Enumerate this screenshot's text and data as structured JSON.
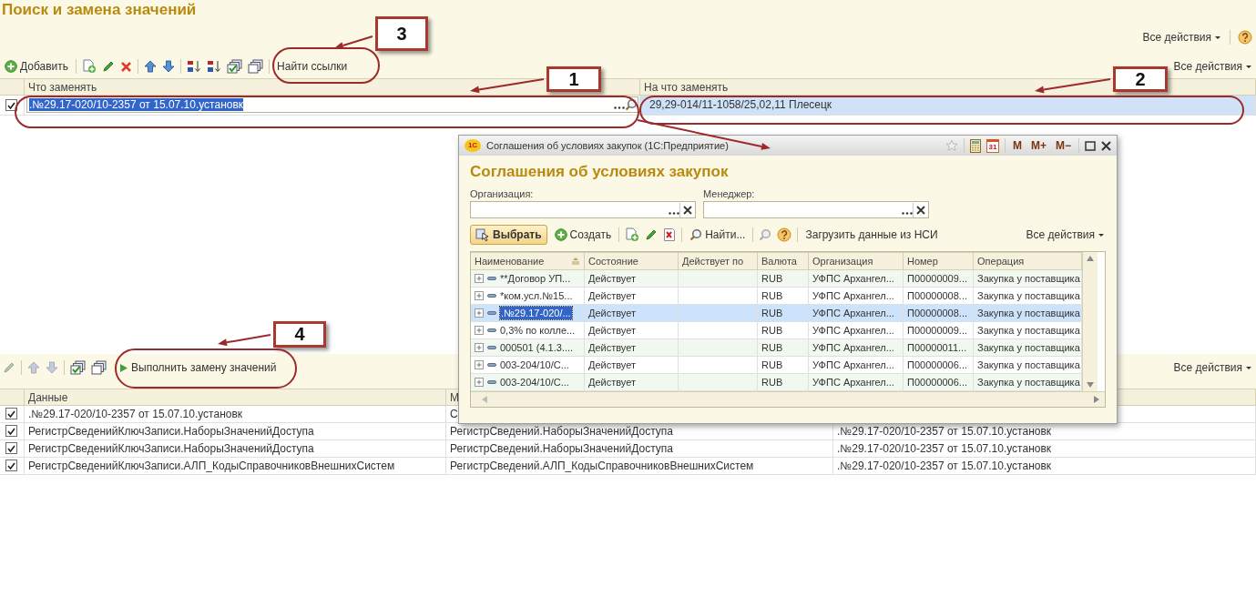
{
  "page": {
    "title": "Поиск и замена значений",
    "all_actions": "Все действия"
  },
  "top_toolbar": {
    "add": "Добавить",
    "find_links": "Найти ссылки",
    "all_actions": "Все действия"
  },
  "replace_table": {
    "columns": [
      "Что заменять",
      "На что заменять"
    ],
    "rows": [
      {
        "checked": true,
        "selected": true,
        "what": ".№29.17-020/10-2357 от 15.07.10.установк",
        "with": "29,29-014/11-1058/25,02,11 Плесецк"
      }
    ]
  },
  "results_toolbar": {
    "run": "Выполнить замену значений",
    "all_actions": "Все действия"
  },
  "results_table": {
    "columns": [
      "Данные",
      "М"
    ],
    "rows": [
      {
        "checked": true,
        "cells": [
          ".№29.17-020/10-2357 от 15.07.10.установк",
          "С"
        ]
      },
      {
        "checked": true,
        "cells": [
          "РегистрСведенийКлючЗаписи.НаборыЗначенийДоступа",
          "РегистрСведений.НаборыЗначенийДоступа",
          ".№29.17-020/10-2357 от 15.07.10.установк"
        ]
      },
      {
        "checked": true,
        "cells": [
          "РегистрСведенийКлючЗаписи.НаборыЗначенийДоступа",
          "РегистрСведений.НаборыЗначенийДоступа",
          ".№29.17-020/10-2357 от 15.07.10.установк"
        ]
      },
      {
        "checked": true,
        "cells": [
          "РегистрСведенийКлючЗаписи.АЛП_КодыСправочниковВнешнихСистем",
          "РегистрСведений.АЛП_КодыСправочниковВнешнихСистем",
          ".№29.17-020/10-2357 от 15.07.10.установк"
        ]
      }
    ]
  },
  "dialog": {
    "logo": "1С",
    "title": "Соглашения об условиях закупок (1С:Предприятие)",
    "calendar_day": "31",
    "memory_buttons": [
      "M",
      "M+",
      "M−"
    ],
    "heading": "Соглашения об условиях закупок",
    "filters": [
      {
        "label": "Организация:"
      },
      {
        "label": "Менеджер:"
      }
    ],
    "toolbar": {
      "select": "Выбрать",
      "create": "Создать",
      "find": "Найти...",
      "load": "Загрузить данные из НСИ",
      "all_actions": "Все действия"
    },
    "table": {
      "columns": [
        "Наименование",
        "Состояние",
        "Действует по",
        "Валюта",
        "Организация",
        "Номер",
        "Операция"
      ],
      "rows": [
        {
          "selected": false,
          "cells": [
            "**Договор УП...",
            "Действует",
            "",
            "RUB",
            "УФПС Архангел...",
            "П00000009...",
            "Закупка у поставщика"
          ]
        },
        {
          "selected": false,
          "cells": [
            "*ком.усл.№15...",
            "Действует",
            "",
            "RUB",
            "УФПС Архангел...",
            "П00000008...",
            "Закупка у поставщика"
          ]
        },
        {
          "selected": true,
          "cells": [
            ".№29.17-020/...",
            "Действует",
            "",
            "RUB",
            "УФПС Архангел...",
            "П00000008...",
            "Закупка у поставщика"
          ]
        },
        {
          "selected": false,
          "cells": [
            "0,3% по колле...",
            "Действует",
            "",
            "RUB",
            "УФПС Архангел...",
            "П00000009...",
            "Закупка у поставщика"
          ]
        },
        {
          "selected": false,
          "cells": [
            "000501 (4.1.3....",
            "Действует",
            "",
            "RUB",
            "УФПС Архангел...",
            "П00000011...",
            "Закупка у поставщика"
          ]
        },
        {
          "selected": false,
          "cells": [
            "003-204/10/С...",
            "Действует",
            "",
            "RUB",
            "УФПС Архангел...",
            "П00000006...",
            "Закупка у поставщика"
          ]
        },
        {
          "selected": false,
          "cells": [
            "003-204/10/С...",
            "Действует",
            "",
            "RUB",
            "УФПС Архангел...",
            "П00000006...",
            "Закупка у поставщика"
          ]
        }
      ]
    }
  },
  "annotations": [
    {
      "number": "3"
    },
    {
      "number": "1"
    },
    {
      "number": "2"
    },
    {
      "number": "4"
    }
  ]
}
